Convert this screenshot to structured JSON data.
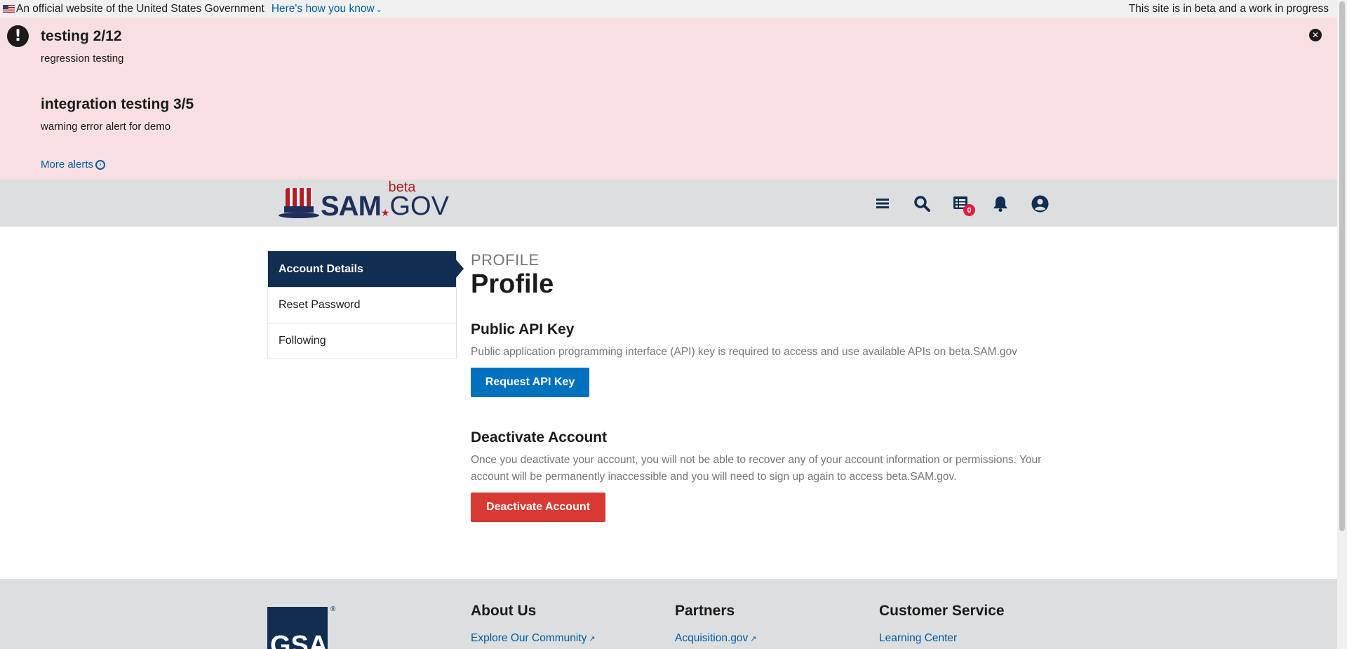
{
  "gov_banner": {
    "official_text": "An official website of the United States Government",
    "how_link": "Here's how you know",
    "beta_note": "This site is in beta and a work in progress"
  },
  "alerts": {
    "items": [
      {
        "title": "testing 2/12",
        "body": "regression testing"
      },
      {
        "title": "integration testing 3/5",
        "body": "warning error alert for demo"
      }
    ],
    "more_label": "More alerts",
    "icon": "exclamation-icon",
    "close_icon": "close-icon",
    "bg_color": "#f8dfe2"
  },
  "header": {
    "logo": {
      "sam": "SAM",
      "gov": "GOV",
      "beta": "beta"
    },
    "icons": [
      "menu-icon",
      "search-icon",
      "messages-icon",
      "notifications-icon",
      "account-icon"
    ],
    "messages_count": "0",
    "bg_color": "#dcdee0"
  },
  "sidenav": {
    "items": [
      {
        "label": "Account Details",
        "active": true
      },
      {
        "label": "Reset Password",
        "active": false
      },
      {
        "label": "Following",
        "active": false
      }
    ],
    "active_color": "#112e51"
  },
  "main": {
    "eyebrow": "PROFILE",
    "title": "Profile",
    "api_section": {
      "title": "Public API Key",
      "description": "Public application programming interface (API) key is required to access and use available APIs on beta.SAM.gov",
      "button": "Request API Key",
      "button_color": "#0071bc"
    },
    "deactivate_section": {
      "title": "Deactivate Account",
      "description": "Once you deactivate your account, you will not be able to recover any of your account information or permissions. Your account will be permanently inaccessible and you will need to sign up again to access beta.SAM.gov.",
      "button": "Deactivate Account",
      "button_color": "#d83933"
    }
  },
  "footer": {
    "logo_text": "GSA",
    "logo_reg": "®",
    "columns": [
      {
        "title": "About Us",
        "links": [
          {
            "label": "Explore Our Community",
            "external": true
          }
        ]
      },
      {
        "title": "Partners",
        "links": [
          {
            "label": "Acquisition.gov",
            "external": true
          }
        ]
      },
      {
        "title": "Customer Service",
        "links": [
          {
            "label": "Learning Center",
            "external": false
          }
        ]
      }
    ]
  }
}
